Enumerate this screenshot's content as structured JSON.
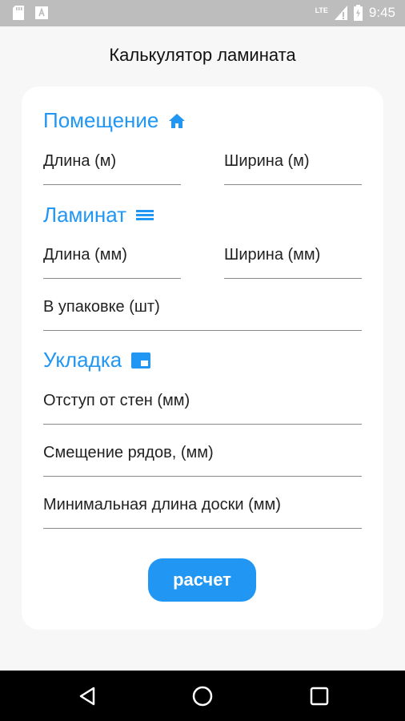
{
  "status_bar": {
    "time": "9:45",
    "network": "LTE",
    "left_icons": [
      "sd-card-icon",
      "text-a-icon"
    ],
    "right_icons": [
      "signal-icon",
      "battery-icon"
    ]
  },
  "title": "Калькулятор ламината",
  "sections": {
    "room": {
      "title": "Помещение",
      "icon": "home-icon",
      "fields": {
        "length": "Длина (м)",
        "width": "Ширина (м)"
      }
    },
    "laminate": {
      "title": "Ламинат",
      "icon": "layers-icon",
      "fields": {
        "length": "Длина (мм)",
        "width": "Ширина (мм)",
        "pack_count": "В упаковке (шт)"
      }
    },
    "laying": {
      "title": "Укладка",
      "icon": "web-asset-icon",
      "fields": {
        "wall_offset": "Отступ от стен (мм)",
        "row_shift": "Смещение рядов, (мм)",
        "min_board": "Минимальная длина доски (мм)"
      }
    }
  },
  "calculate_button": "расчет",
  "nav_bar": {
    "icons": [
      "back-icon",
      "home-circle-icon",
      "recents-icon"
    ]
  },
  "colors": {
    "accent": "#2196f3",
    "status_bar": "#bdbdbd",
    "background": "#f7f7f7",
    "nav_bar": "#000000"
  }
}
